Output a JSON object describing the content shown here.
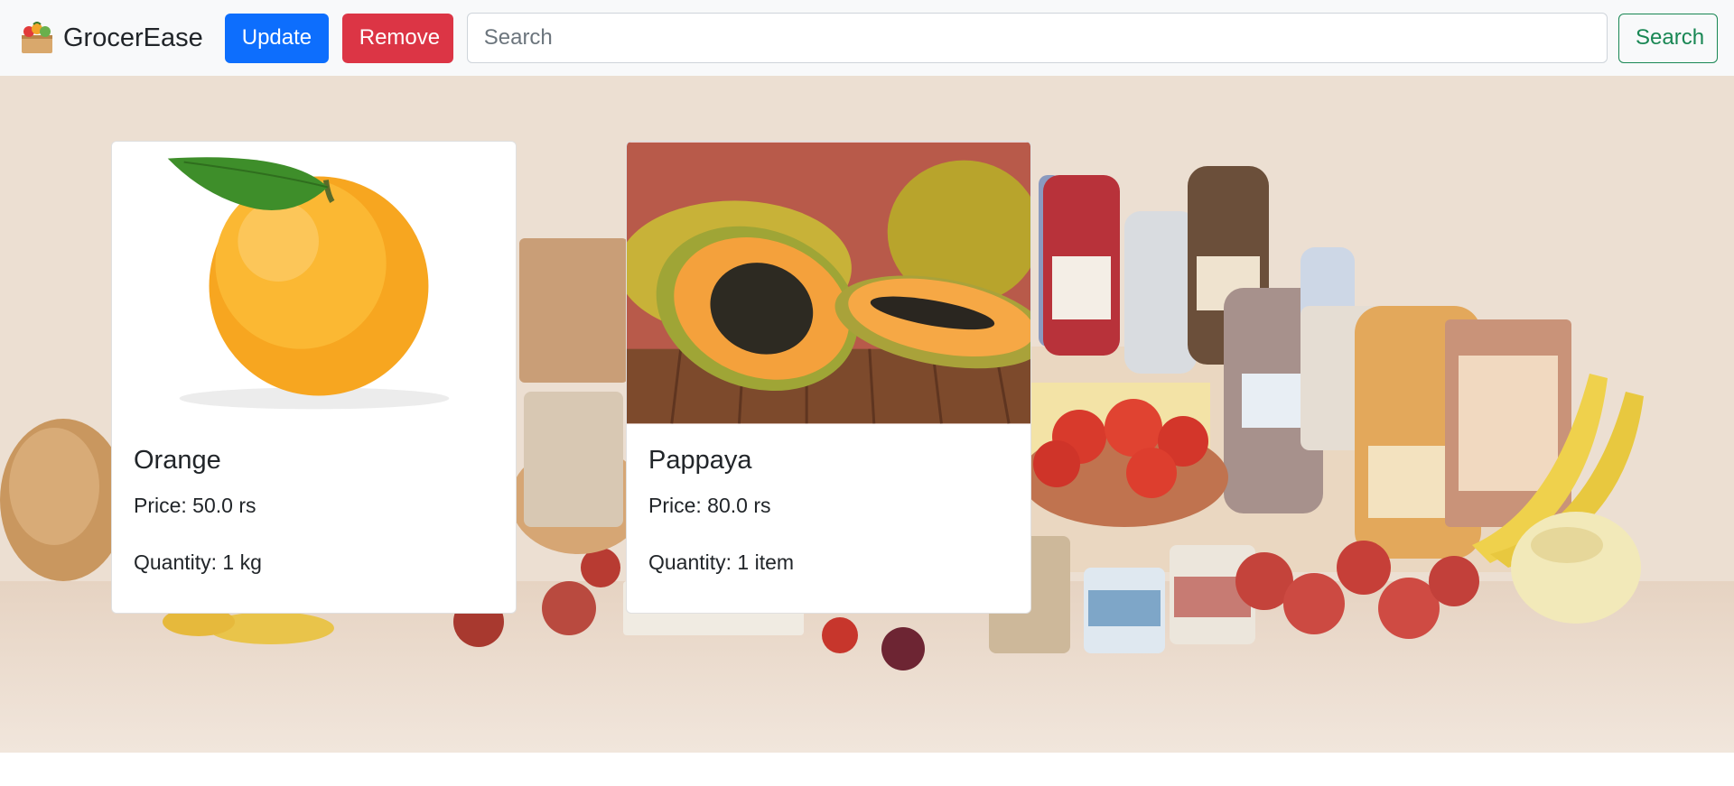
{
  "app": {
    "name": "GrocerEase",
    "logo_icon": "grocery-basket-icon"
  },
  "toolbar": {
    "update_label": "Update",
    "remove_label": "Remove",
    "search_placeholder": "Search",
    "search_value": "",
    "search_button_label": "Search"
  },
  "colors": {
    "update": "#0d6efd",
    "remove": "#dc3545",
    "search_outline": "#198754",
    "navbar_bg": "#f8f9fa"
  },
  "hero": {
    "background_icon": "grocery-assortment-background"
  },
  "products": [
    {
      "name": "Orange",
      "price": "Price: 50.0 rs",
      "quantity": "Quantity: 1 kg",
      "image_icon": "orange-image"
    },
    {
      "name": "Pappaya",
      "price": "Price: 80.0 rs",
      "quantity": "Quantity: 1 item",
      "image_icon": "papaya-image"
    }
  ]
}
